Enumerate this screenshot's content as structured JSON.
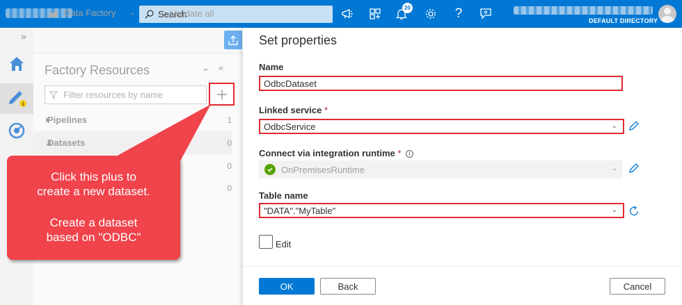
{
  "header": {
    "search_placeholder": "Search",
    "notification_count": "20",
    "directory": "DEFAULT DIRECTORY",
    "icons": [
      "announcement-icon",
      "portal-menu-icon",
      "bell-icon",
      "gear-icon",
      "help-icon",
      "feedback-icon"
    ]
  },
  "factory_toolbar": {
    "factory_label": "Data Factory",
    "validate_label": "Validate all"
  },
  "resources": {
    "title": "Factory Resources",
    "filter_placeholder": "Filter resources by name",
    "items": [
      {
        "label": "Pipelines",
        "count": "1"
      },
      {
        "label": "Datasets",
        "count": "0"
      },
      {
        "label": "",
        "count": "0"
      },
      {
        "label": "",
        "count": "0"
      }
    ]
  },
  "callout": {
    "line1": "Click this plus to create a new dataset.",
    "line2": "Create a dataset based on \"ODBC\""
  },
  "properties": {
    "title": "Set properties",
    "name_label": "Name",
    "name_value": "OdbcDataset",
    "linked_service_label": "Linked service",
    "linked_service_value": "OdbcService",
    "runtime_label": "Connect via integration runtime",
    "runtime_value": "OnPremisesRuntime",
    "table_label": "Table name",
    "table_value": "\"DATA\".\"MyTable\"",
    "edit_label": "Edit",
    "required_mark": "*"
  },
  "buttons": {
    "ok": "OK",
    "back": "Back",
    "cancel": "Cancel"
  },
  "colors": {
    "accent": "#0078d4",
    "highlight": "#e0292f",
    "callout": "#f0434b",
    "success": "#57a300"
  }
}
